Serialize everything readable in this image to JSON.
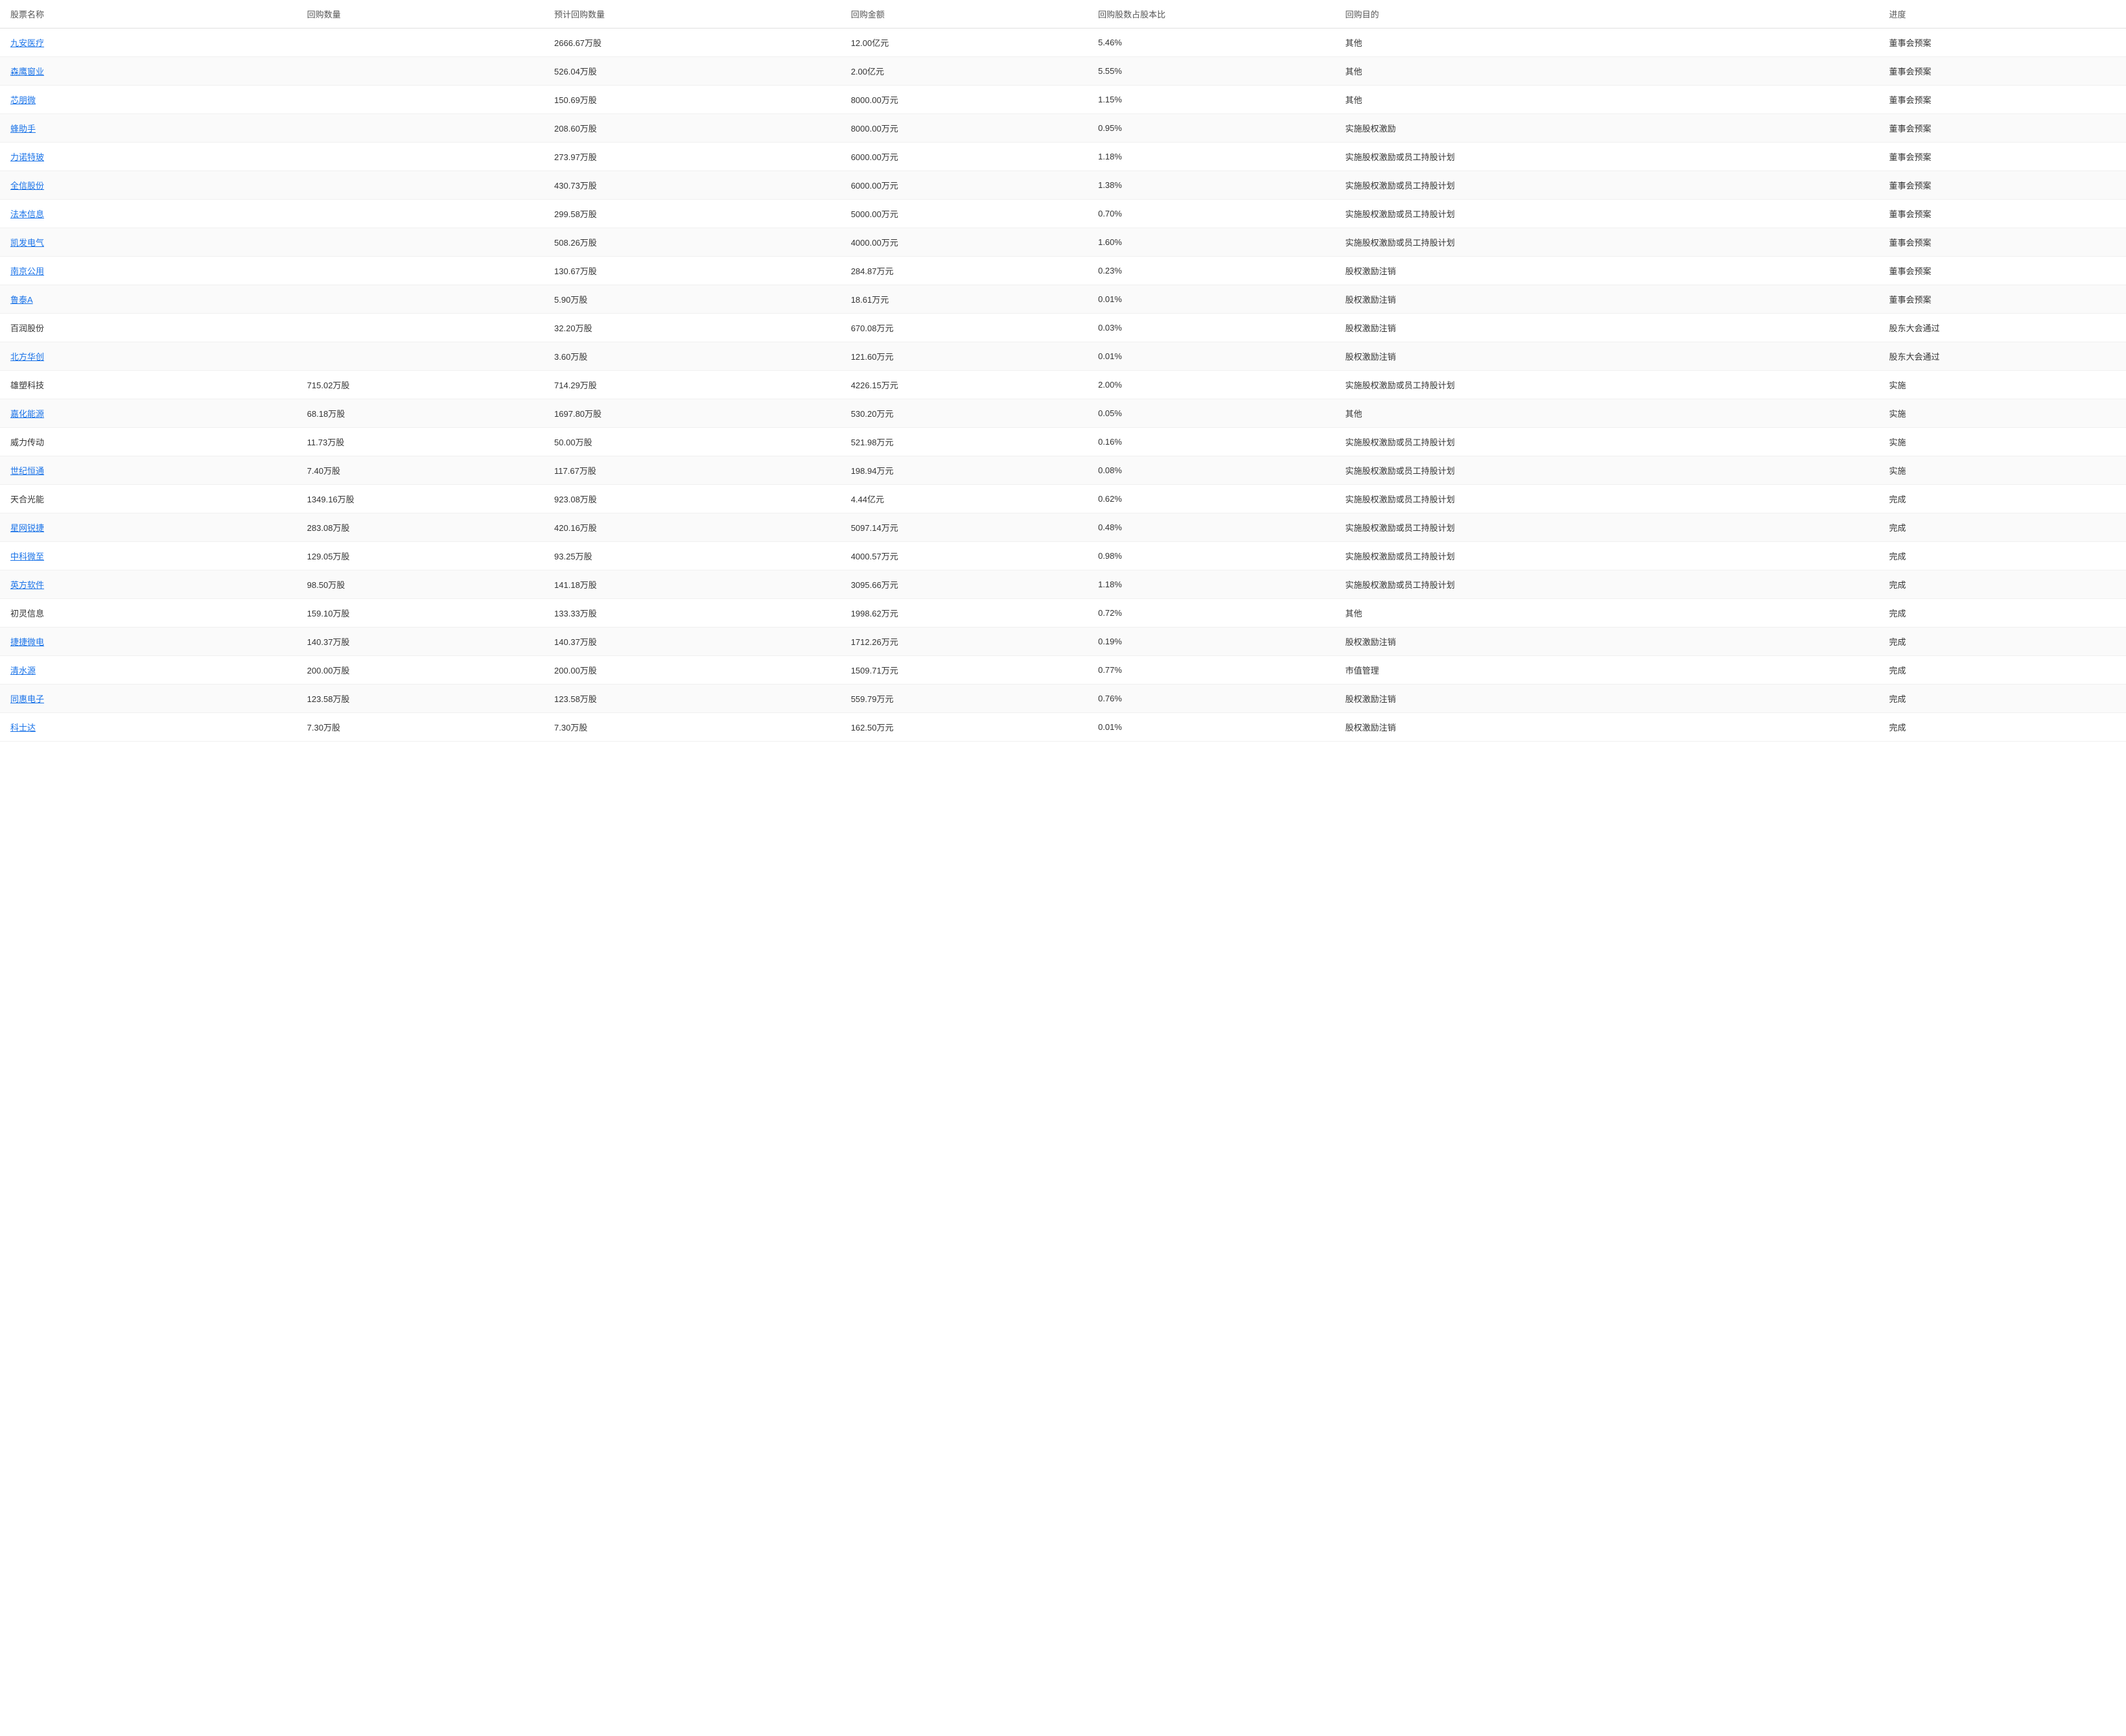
{
  "table": {
    "headers": [
      "股票名称",
      "回购数量",
      "预计回购数量",
      "回购金额",
      "回购股数占股本比",
      "回购目的",
      "进度"
    ],
    "rows": [
      {
        "name": "九安医疗",
        "link": true,
        "buyback_qty": "",
        "planned_qty": "2666.67万股",
        "amount": "12.00亿元",
        "pct": "5.46%",
        "purpose": "其他",
        "progress": "董事会预案"
      },
      {
        "name": "森鹰窗业",
        "link": true,
        "buyback_qty": "",
        "planned_qty": "526.04万股",
        "amount": "2.00亿元",
        "pct": "5.55%",
        "purpose": "其他",
        "progress": "董事会预案"
      },
      {
        "name": "芯朋微",
        "link": true,
        "buyback_qty": "",
        "planned_qty": "150.69万股",
        "amount": "8000.00万元",
        "pct": "1.15%",
        "purpose": "其他",
        "progress": "董事会预案"
      },
      {
        "name": "蜂助手",
        "link": true,
        "buyback_qty": "",
        "planned_qty": "208.60万股",
        "amount": "8000.00万元",
        "pct": "0.95%",
        "purpose": "实施股权激励",
        "progress": "董事会预案"
      },
      {
        "name": "力诺特玻",
        "link": true,
        "buyback_qty": "",
        "planned_qty": "273.97万股",
        "amount": "6000.00万元",
        "pct": "1.18%",
        "purpose": "实施股权激励或员工持股计划",
        "progress": "董事会预案"
      },
      {
        "name": "全信股份",
        "link": true,
        "buyback_qty": "",
        "planned_qty": "430.73万股",
        "amount": "6000.00万元",
        "pct": "1.38%",
        "purpose": "实施股权激励或员工持股计划",
        "progress": "董事会预案"
      },
      {
        "name": "法本信息",
        "link": true,
        "buyback_qty": "",
        "planned_qty": "299.58万股",
        "amount": "5000.00万元",
        "pct": "0.70%",
        "purpose": "实施股权激励或员工持股计划",
        "progress": "董事会预案"
      },
      {
        "name": "凯发电气",
        "link": true,
        "buyback_qty": "",
        "planned_qty": "508.26万股",
        "amount": "4000.00万元",
        "pct": "1.60%",
        "purpose": "实施股权激励或员工持股计划",
        "progress": "董事会预案"
      },
      {
        "name": "南京公用",
        "link": true,
        "buyback_qty": "",
        "planned_qty": "130.67万股",
        "amount": "284.87万元",
        "pct": "0.23%",
        "purpose": "股权激励注销",
        "progress": "董事会预案"
      },
      {
        "name": "鲁泰A",
        "link": true,
        "buyback_qty": "",
        "planned_qty": "5.90万股",
        "amount": "18.61万元",
        "pct": "0.01%",
        "purpose": "股权激励注销",
        "progress": "董事会预案"
      },
      {
        "name": "百润股份",
        "link": false,
        "buyback_qty": "",
        "planned_qty": "32.20万股",
        "amount": "670.08万元",
        "pct": "0.03%",
        "purpose": "股权激励注销",
        "progress": "股东大会通过"
      },
      {
        "name": "北方华创",
        "link": true,
        "buyback_qty": "",
        "planned_qty": "3.60万股",
        "amount": "121.60万元",
        "pct": "0.01%",
        "purpose": "股权激励注销",
        "progress": "股东大会通过"
      },
      {
        "name": "雄塑科技",
        "link": false,
        "buyback_qty": "715.02万股",
        "planned_qty": "714.29万股",
        "amount": "4226.15万元",
        "pct": "2.00%",
        "purpose": "实施股权激励或员工持股计划",
        "progress": "实施"
      },
      {
        "name": "嘉化能源",
        "link": true,
        "buyback_qty": "68.18万股",
        "planned_qty": "1697.80万股",
        "amount": "530.20万元",
        "pct": "0.05%",
        "purpose": "其他",
        "progress": "实施"
      },
      {
        "name": "威力传动",
        "link": false,
        "buyback_qty": "11.73万股",
        "planned_qty": "50.00万股",
        "amount": "521.98万元",
        "pct": "0.16%",
        "purpose": "实施股权激励或员工持股计划",
        "progress": "实施"
      },
      {
        "name": "世纪恒通",
        "link": true,
        "buyback_qty": "7.40万股",
        "planned_qty": "117.67万股",
        "amount": "198.94万元",
        "pct": "0.08%",
        "purpose": "实施股权激励或员工持股计划",
        "progress": "实施"
      },
      {
        "name": "天合光能",
        "link": false,
        "buyback_qty": "1349.16万股",
        "planned_qty": "923.08万股",
        "amount": "4.44亿元",
        "pct": "0.62%",
        "purpose": "实施股权激励或员工持股计划",
        "progress": "完成"
      },
      {
        "name": "星网锐捷",
        "link": true,
        "buyback_qty": "283.08万股",
        "planned_qty": "420.16万股",
        "amount": "5097.14万元",
        "pct": "0.48%",
        "purpose": "实施股权激励或员工持股计划",
        "progress": "完成"
      },
      {
        "name": "中科微至",
        "link": true,
        "buyback_qty": "129.05万股",
        "planned_qty": "93.25万股",
        "amount": "4000.57万元",
        "pct": "0.98%",
        "purpose": "实施股权激励或员工持股计划",
        "progress": "完成"
      },
      {
        "name": "英方软件",
        "link": true,
        "buyback_qty": "98.50万股",
        "planned_qty": "141.18万股",
        "amount": "3095.66万元",
        "pct": "1.18%",
        "purpose": "实施股权激励或员工持股计划",
        "progress": "完成"
      },
      {
        "name": "初灵信息",
        "link": false,
        "buyback_qty": "159.10万股",
        "planned_qty": "133.33万股",
        "amount": "1998.62万元",
        "pct": "0.72%",
        "purpose": "其他",
        "progress": "完成"
      },
      {
        "name": "捷捷微电",
        "link": true,
        "buyback_qty": "140.37万股",
        "planned_qty": "140.37万股",
        "amount": "1712.26万元",
        "pct": "0.19%",
        "purpose": "股权激励注销",
        "progress": "完成"
      },
      {
        "name": "清水源",
        "link": true,
        "buyback_qty": "200.00万股",
        "planned_qty": "200.00万股",
        "amount": "1509.71万元",
        "pct": "0.77%",
        "purpose": "市值管理",
        "progress": "完成"
      },
      {
        "name": "同惠电子",
        "link": true,
        "buyback_qty": "123.58万股",
        "planned_qty": "123.58万股",
        "amount": "559.79万元",
        "pct": "0.76%",
        "purpose": "股权激励注销",
        "progress": "完成"
      },
      {
        "name": "科士达",
        "link": true,
        "buyback_qty": "7.30万股",
        "planned_qty": "7.30万股",
        "amount": "162.50万元",
        "pct": "0.01%",
        "purpose": "股权激励注销",
        "progress": "完成"
      }
    ]
  }
}
